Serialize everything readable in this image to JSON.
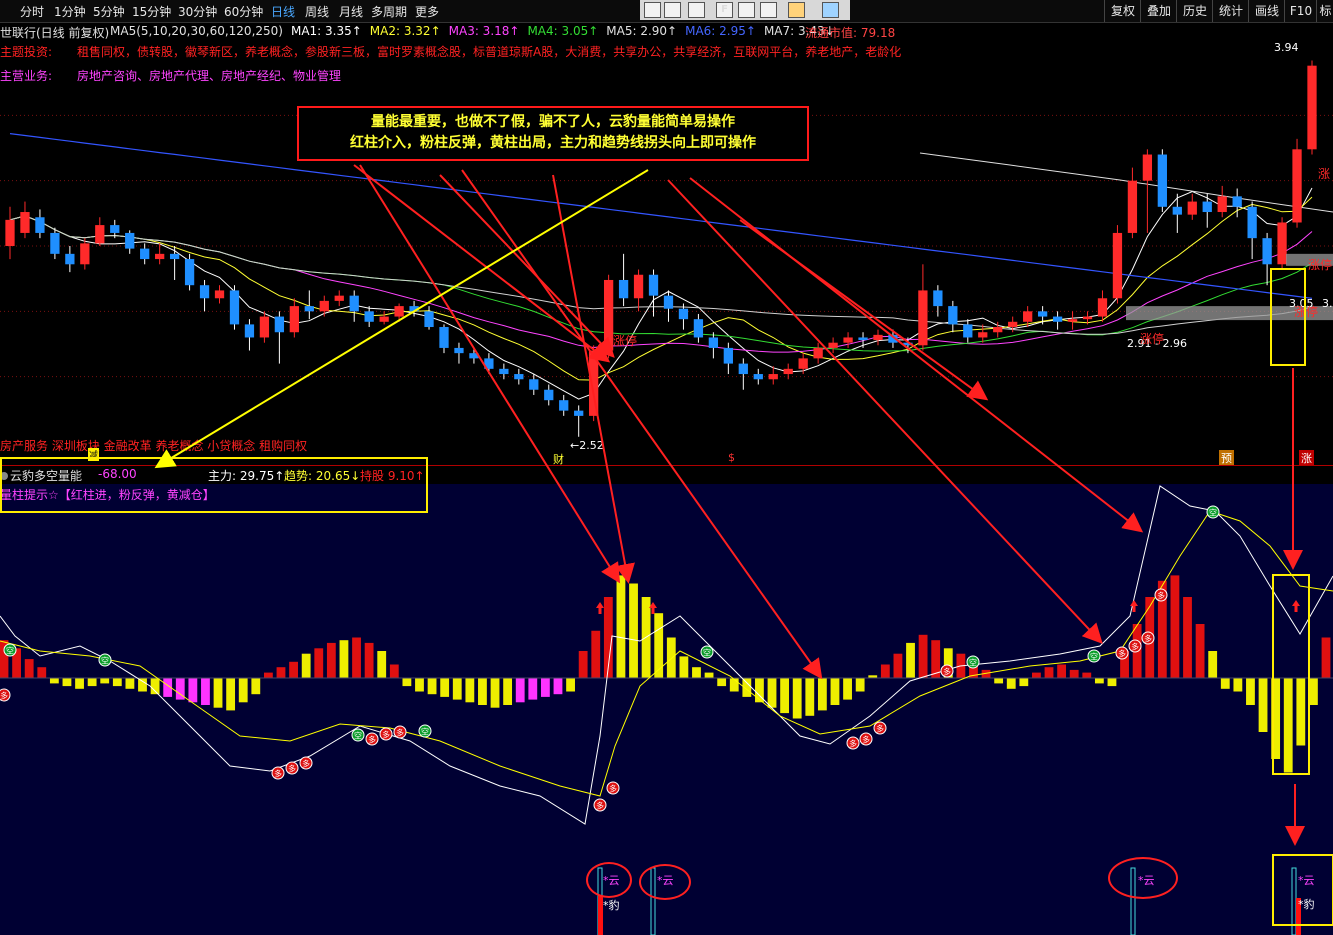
{
  "toolbar": {
    "periods": [
      "分时",
      "1分钟",
      "5分钟",
      "15分钟",
      "30分钟",
      "60分钟",
      "日线",
      "周线",
      "月线",
      "多周期",
      "更多"
    ],
    "active_period": "日线",
    "right_buttons": [
      "复权",
      "叠加",
      "历史",
      "统计",
      "画线",
      "F10",
      "标"
    ]
  },
  "stock": {
    "title": "世联行(日线 前复权)"
  },
  "ma_legend": [
    {
      "text": "MA5(5,10,20,30,60,120,250)",
      "color": "#e0e0e0"
    },
    {
      "text": "MA1: 3.35↑",
      "color": "#ffffff"
    },
    {
      "text": "MA2: 3.32↑",
      "color": "#ffff33"
    },
    {
      "text": "MA3: 3.18↑",
      "color": "#ff44ff"
    },
    {
      "text": "MA4: 3.05↑",
      "color": "#33dd33"
    },
    {
      "text": "MA5: 2.90↑",
      "color": "#e0e0e0"
    },
    {
      "text": "MA6: 2.95↑",
      "color": "#4466ff"
    },
    {
      "text": "MA7: 3.43↓",
      "color": "#e0e0e0"
    }
  ],
  "market_cap_label": "流通市值: 79.18",
  "info": {
    "theme_label": "主题投资:",
    "theme_text": "租售同权，债转股，徽琴新区，养老概念，参股新三板，富时罗素概念股，标普道琼斯A股，大消费，共享办公，共享经济，互联网平台，养老地产，老龄化",
    "business_label": "主营业务:",
    "business_text": "房地产咨询、房地产代理、房地产经纪、物业管理"
  },
  "callout": {
    "line1": "量能最重要，也做不了假，骗不了人，云豹量能简单易操作",
    "line2": "红柱介入，粉柱反弹，黄柱出局，主力和趋势线拐头向上即可操作"
  },
  "price_labels": {
    "high": "3.94",
    "low": "←2.52",
    "range": "2.91 - 2.96",
    "current": "3.05",
    "current2": "3."
  },
  "chart_markers": {
    "zhangting1": "涨停",
    "zhangting2": "涨停",
    "zhangting3": "涨停",
    "zhangting_mid": "涨停",
    "zhang": "涨",
    "cai": "财",
    "s": "$",
    "yu": "预",
    "zhang_bottom": "涨",
    "jian": "减"
  },
  "sector_line": "房产服务 深圳板块 金融改革 养老概念 小贷概念 租购同权",
  "indicator": {
    "name": "云豹多空量能",
    "value": "-68.00",
    "zhuli": "主力: 29.75↑",
    "qushi": "趋势: 20.65↓",
    "chigu": "持股  9.10↑",
    "hint": "量柱提示☆【红柱进，粉反弹，黄减仓】",
    "bottom_yun": "*云",
    "bottom_bao": "*豹"
  },
  "badges": {
    "kong": "空",
    "duo": "多"
  },
  "colors": {
    "up": "#ff2a2a",
    "down": "#1f8fff",
    "bar_red": "#e01010",
    "bar_yellow": "#eeee00",
    "bar_pink": "#ff33ff",
    "panel_bg": "#000033",
    "arrow_red": "#ff2020",
    "arrow_yellow": "#ffff00"
  },
  "chart_data": {
    "type": "candlestick",
    "title": "世联行(日线 前复权)",
    "ylim": [
      2.5,
      4.0
    ],
    "candles": [
      [
        3.25,
        3.35,
        3.2,
        3.4
      ],
      [
        3.3,
        3.38,
        3.28,
        3.42
      ],
      [
        3.36,
        3.3,
        3.28,
        3.39
      ],
      [
        3.3,
        3.22,
        3.2,
        3.32
      ],
      [
        3.22,
        3.18,
        3.15,
        3.25
      ],
      [
        3.18,
        3.26,
        3.16,
        3.28
      ],
      [
        3.26,
        3.33,
        3.25,
        3.36
      ],
      [
        3.33,
        3.3,
        3.28,
        3.35
      ],
      [
        3.3,
        3.24,
        3.22,
        3.31
      ],
      [
        3.24,
        3.2,
        3.18,
        3.26
      ],
      [
        3.2,
        3.22,
        3.18,
        3.26
      ],
      [
        3.22,
        3.2,
        3.12,
        3.25
      ],
      [
        3.2,
        3.1,
        3.08,
        3.22
      ],
      [
        3.1,
        3.05,
        3.0,
        3.12
      ],
      [
        3.05,
        3.08,
        3.03,
        3.1
      ],
      [
        3.08,
        2.95,
        2.93,
        3.1
      ],
      [
        2.95,
        2.9,
        2.85,
        2.97
      ],
      [
        2.9,
        2.98,
        2.88,
        3.0
      ],
      [
        2.98,
        2.92,
        2.8,
        3.0
      ],
      [
        2.92,
        3.02,
        2.9,
        3.05
      ],
      [
        3.02,
        3.0,
        2.97,
        3.08
      ],
      [
        3.0,
        3.04,
        2.98,
        3.06
      ],
      [
        3.04,
        3.06,
        3.02,
        3.08
      ],
      [
        3.06,
        3.0,
        2.96,
        3.08
      ],
      [
        3.0,
        2.96,
        2.94,
        3.02
      ],
      [
        2.96,
        2.98,
        2.95,
        3.0
      ],
      [
        2.98,
        3.02,
        2.96,
        3.03
      ],
      [
        3.02,
        3.0,
        2.98,
        3.04
      ],
      [
        3.0,
        2.94,
        2.93,
        3.02
      ],
      [
        2.94,
        2.86,
        2.84,
        2.95
      ],
      [
        2.86,
        2.84,
        2.8,
        2.88
      ],
      [
        2.84,
        2.82,
        2.8,
        2.86
      ],
      [
        2.82,
        2.78,
        2.76,
        2.84
      ],
      [
        2.78,
        2.76,
        2.74,
        2.8
      ],
      [
        2.76,
        2.74,
        2.72,
        2.78
      ],
      [
        2.74,
        2.7,
        2.68,
        2.76
      ],
      [
        2.7,
        2.66,
        2.64,
        2.72
      ],
      [
        2.66,
        2.62,
        2.6,
        2.68
      ],
      [
        2.62,
        2.6,
        2.52,
        2.64
      ],
      [
        2.6,
        2.85,
        2.58,
        2.87
      ],
      [
        2.85,
        3.12,
        2.82,
        3.14
      ],
      [
        3.12,
        3.05,
        3.02,
        3.22
      ],
      [
        3.05,
        3.14,
        3.0,
        3.16
      ],
      [
        3.14,
        3.06,
        2.98,
        3.16
      ],
      [
        3.06,
        3.01,
        2.96,
        3.08
      ],
      [
        3.01,
        2.97,
        2.93,
        3.03
      ],
      [
        2.97,
        2.9,
        2.88,
        2.99
      ],
      [
        2.9,
        2.86,
        2.82,
        2.92
      ],
      [
        2.86,
        2.8,
        2.76,
        2.88
      ],
      [
        2.8,
        2.76,
        2.7,
        2.82
      ],
      [
        2.76,
        2.74,
        2.72,
        2.78
      ],
      [
        2.74,
        2.76,
        2.72,
        2.79
      ],
      [
        2.76,
        2.78,
        2.74,
        2.8
      ],
      [
        2.78,
        2.82,
        2.76,
        2.84
      ],
      [
        2.82,
        2.86,
        2.8,
        2.88
      ],
      [
        2.86,
        2.88,
        2.84,
        2.9
      ],
      [
        2.88,
        2.9,
        2.86,
        2.92
      ],
      [
        2.9,
        2.89,
        2.86,
        2.92
      ],
      [
        2.89,
        2.91,
        2.87,
        2.93
      ],
      [
        2.91,
        2.88,
        2.86,
        2.93
      ],
      [
        2.88,
        2.87,
        2.84,
        2.9
      ],
      [
        2.87,
        3.08,
        2.85,
        3.18
      ],
      [
        3.08,
        3.02,
        2.98,
        3.1
      ],
      [
        3.02,
        2.95,
        2.92,
        3.04
      ],
      [
        2.95,
        2.9,
        2.88,
        2.97
      ],
      [
        2.9,
        2.92,
        2.88,
        2.95
      ],
      [
        2.92,
        2.94,
        2.9,
        2.96
      ],
      [
        2.94,
        2.96,
        2.92,
        2.98
      ],
      [
        2.96,
        3.0,
        2.94,
        3.02
      ],
      [
        3.0,
        2.98,
        2.95,
        3.02
      ],
      [
        2.98,
        2.96,
        2.93,
        3.0
      ],
      [
        2.96,
        2.97,
        2.93,
        3.0
      ],
      [
        2.97,
        2.98,
        2.95,
        3.0
      ],
      [
        2.98,
        3.05,
        2.96,
        3.08
      ],
      [
        3.05,
        3.3,
        3.03,
        3.33
      ],
      [
        3.3,
        3.5,
        3.28,
        3.55
      ],
      [
        3.5,
        3.6,
        3.3,
        3.62
      ],
      [
        3.6,
        3.4,
        3.38,
        3.62
      ],
      [
        3.4,
        3.37,
        3.3,
        3.45
      ],
      [
        3.37,
        3.42,
        3.35,
        3.45
      ],
      [
        3.42,
        3.38,
        3.32,
        3.45
      ],
      [
        3.38,
        3.44,
        3.36,
        3.48
      ],
      [
        3.44,
        3.4,
        3.36,
        3.47
      ],
      [
        3.4,
        3.28,
        3.2,
        3.42
      ],
      [
        3.28,
        3.18,
        3.1,
        3.3
      ],
      [
        3.18,
        3.34,
        3.16,
        3.36
      ],
      [
        3.34,
        3.62,
        3.32,
        3.66
      ],
      [
        3.62,
        3.94,
        3.6,
        3.96
      ]
    ],
    "indicator_hist_note": "red = enter, pink = rebound, yellow = reduce; positive above zero line, negative below",
    "indicator_hist": [
      28,
      22,
      14,
      8,
      -4,
      -6,
      -8,
      -6,
      -4,
      -6,
      -8,
      -10,
      -12,
      -14,
      -16,
      -18,
      -20,
      -22,
      -24,
      -18,
      -12,
      4,
      8,
      12,
      18,
      22,
      26,
      28,
      30,
      26,
      20,
      10,
      -6,
      -10,
      -12,
      -14,
      -16,
      -18,
      -20,
      -22,
      -20,
      -18,
      -16,
      -14,
      -12,
      -10,
      20,
      35,
      60,
      76,
      70,
      60,
      48,
      30,
      16,
      8,
      4,
      -6,
      -10,
      -14,
      -18,
      -22,
      -26,
      -30,
      -28,
      -24,
      -20,
      -16,
      -10,
      2,
      10,
      18,
      26,
      32,
      28,
      22,
      18,
      12,
      6,
      -4,
      -8,
      -6,
      4,
      8,
      10,
      6,
      4,
      -4,
      -6,
      20,
      40,
      60,
      72,
      76,
      60,
      40,
      20,
      -8,
      -10,
      -20,
      -40,
      -60,
      -70,
      -50,
      -20,
      30
    ]
  }
}
